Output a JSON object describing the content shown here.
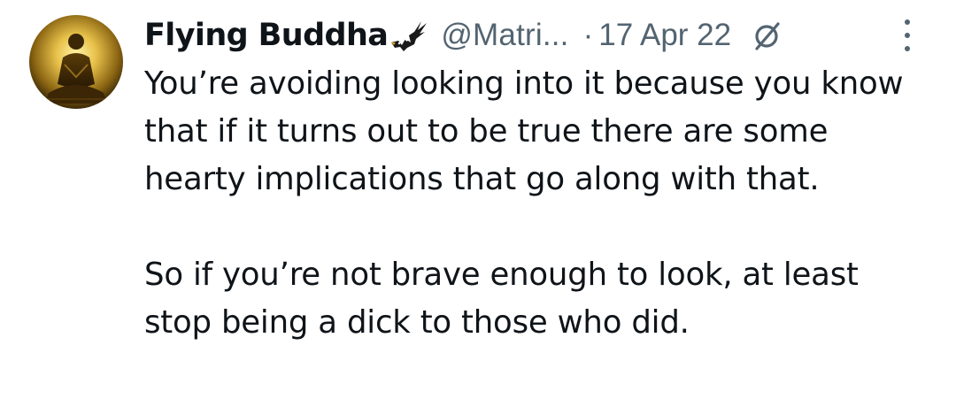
{
  "tweet": {
    "author": {
      "display_name": "Flying Buddha",
      "badge_icon": "eagle-icon",
      "handle": "@Matri...",
      "avatar_icon": "buddha-avatar"
    },
    "separator": "·",
    "date": "17 Apr 22",
    "audience_icon": "globe-icon",
    "menu_icon": "more-options-icon",
    "text_paragraphs": [
      "You’re avoiding looking into it because you know that if it turns out to be true there are some hearty implications that go along with that.",
      "So if you’re not brave enough to look, at least stop being a dick to those who did."
    ]
  },
  "colors": {
    "text_primary": "#0f1419",
    "text_secondary": "#536471",
    "background": "#ffffff"
  }
}
